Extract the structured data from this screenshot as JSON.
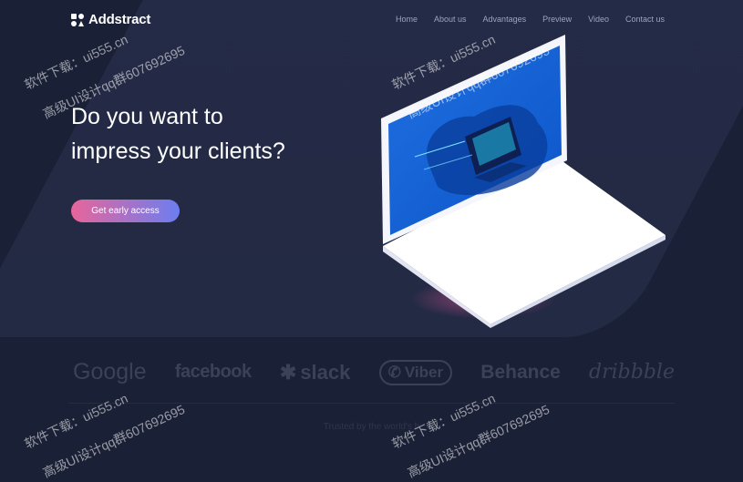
{
  "brand": {
    "name": "Addstract"
  },
  "nav": [
    "Home",
    "About us",
    "Advantages",
    "Preview",
    "Video",
    "Contact us"
  ],
  "hero": {
    "title_line1": "Do you want to",
    "title_line2": "impress your clients?",
    "cta_label": "Get early access"
  },
  "partners": [
    "Google",
    "facebook",
    "slack",
    "Viber",
    "Behance",
    "dribbble"
  ],
  "trusted_text": "Trusted by the world's b",
  "watermark": {
    "line1": "软件下载：ui555.cn",
    "line2": "高级UI设计qq群607692695"
  },
  "colors": {
    "background": "#1a2035",
    "cta_start": "#e8659a",
    "cta_end": "#6b7ef0",
    "screen": "#1565d8"
  }
}
